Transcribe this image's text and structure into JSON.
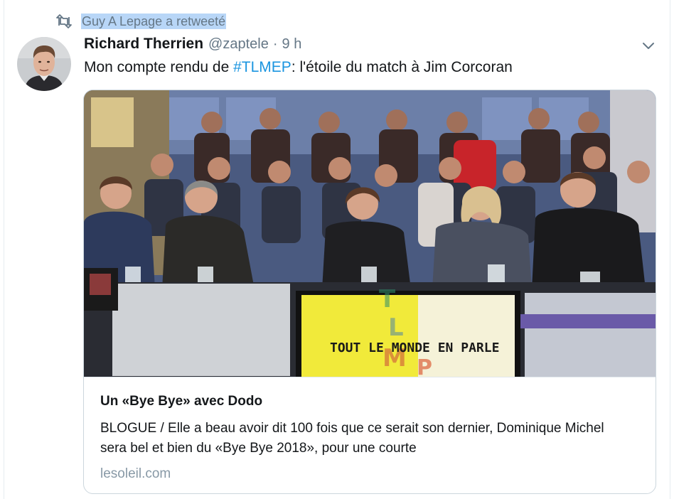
{
  "retweet": {
    "icon": "retweet-icon",
    "label": "Guy A Lepage a retweeté"
  },
  "tweet": {
    "author_name": "Richard Therrien",
    "author_handle": "@zaptele",
    "separator": "·",
    "time": "9 h",
    "text_before": "Mon compte rendu de ",
    "hashtag": "#TLMEP",
    "text_after": ": l'étoile du match à Jim Corcoran",
    "menu_icon": "chevron-down-icon"
  },
  "card": {
    "image_sign_text": "TOUT LE MONDE EN PARLE",
    "title": "Un «Bye Bye» avec Dodo",
    "description": "BLOGUE / Elle a beau avoir dit 100 fois que ce serait son dernier, Dominique Michel sera bel et bien du «Bye Bye 2018», pour une courte",
    "domain": "lesoleil.com"
  },
  "colors": {
    "link": "#1b95e0",
    "secondary_text": "#657786",
    "selection_highlight": "#b8d6f7",
    "card_border": "#ccd6dd"
  }
}
